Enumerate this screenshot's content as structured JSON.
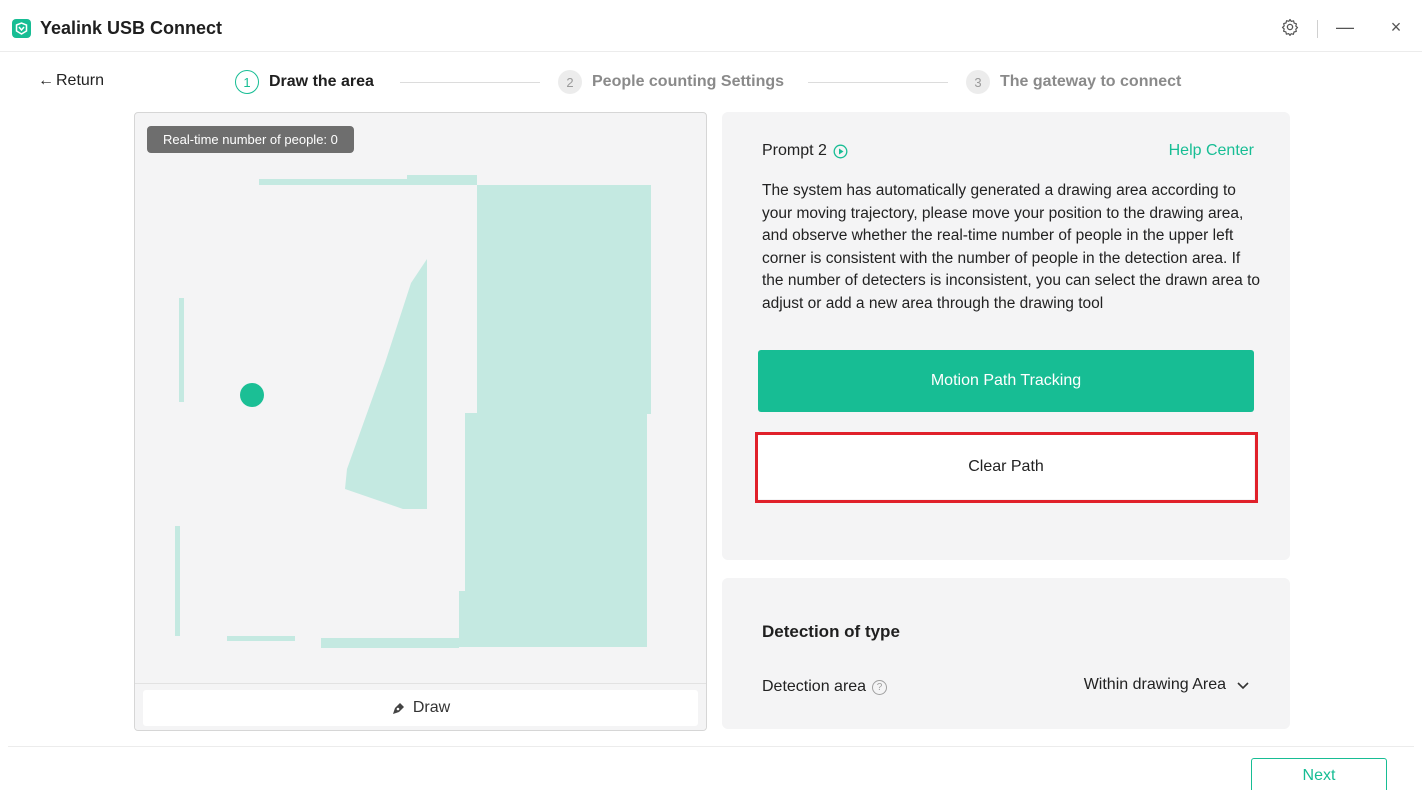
{
  "app": {
    "title": "Yealink USB Connect",
    "logo_icon": "yealink-logo",
    "accent_color": "#17bd94"
  },
  "window_controls": {
    "settings_icon": "gear-icon",
    "minimize_symbol": "—",
    "close_symbol": "×"
  },
  "nav": {
    "return_label": "Return",
    "return_arrow": "←"
  },
  "steps": [
    {
      "number": "1",
      "label": "Draw the area",
      "state": "active"
    },
    {
      "number": "2",
      "label": "People counting Settings",
      "state": "inactive"
    },
    {
      "number": "3",
      "label": "The gateway to connect",
      "state": "inactive"
    }
  ],
  "canvas": {
    "people_badge": "Real-time number of people: 0",
    "draw_button_label": "Draw"
  },
  "prompt": {
    "title": "Prompt 2",
    "help_link": "Help Center",
    "text": "The system has automatically generated a drawing area according to your moving trajectory, please move your position to the drawing area, and observe whether the real-time number of people in the upper left corner is consistent with the number of people in the detection area. If the number of detecters is inconsistent, you can select the drawn area to adjust or add a new area through the drawing tool",
    "primary_button": "Motion Path Tracking",
    "secondary_button": "Clear Path",
    "highlight_color": "#e0202a"
  },
  "detection": {
    "heading": "Detection of type",
    "area_label": "Detection area",
    "area_value": "Within drawing Area"
  },
  "footer": {
    "next_label": "Next"
  }
}
